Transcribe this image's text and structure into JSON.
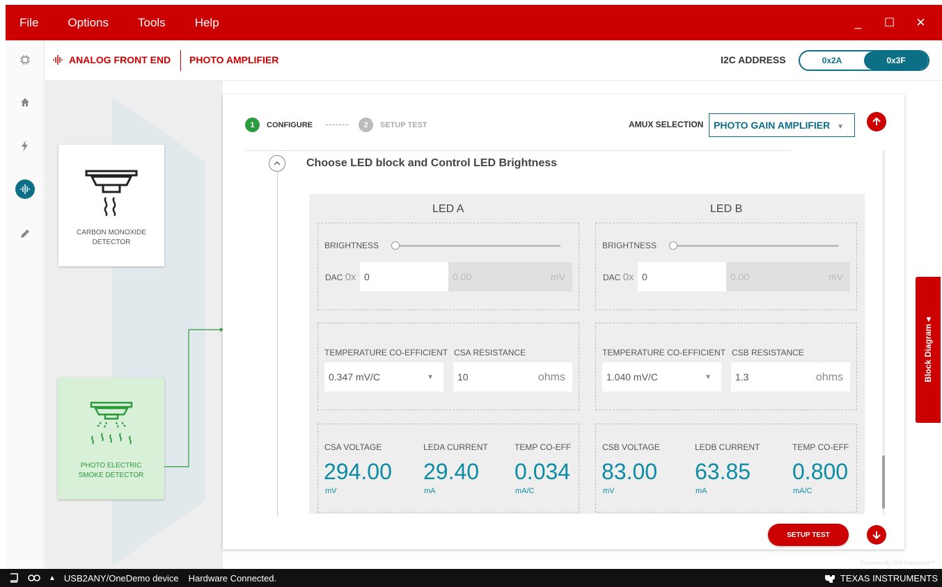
{
  "menu": {
    "items": [
      "File",
      "Options",
      "Tools",
      "Help"
    ]
  },
  "window_controls": {
    "minimize": "_",
    "maximize": "☐",
    "close": "✕"
  },
  "header": {
    "afe_label": "ANALOG FRONT END",
    "pa_label": "PHOTO AMPLIFIER",
    "i2c_label": "I2C ADDRESS",
    "i2c_options": [
      "0x2A",
      "0x3F"
    ],
    "i2c_selected": "0x3F"
  },
  "diagram": {
    "co_label_1": "CARBON MONOXIDE",
    "co_label_2": "DETECTOR",
    "pe_label_1": "PHOTO ELECTRIC",
    "pe_label_2": "SMOKE DETECTOR"
  },
  "steps": {
    "step1_num": "1",
    "step1_label": "CONFIGURE",
    "step2_num": "2",
    "step2_label": "SETUP TEST"
  },
  "amux": {
    "label": "AMUX SELECTION",
    "value": "PHOTO GAIN AMPLIFIER"
  },
  "section": {
    "title": "Choose LED block and Control LED Brightness"
  },
  "led_a": {
    "title": "LED A",
    "brightness_label": "BRIGHTNESS",
    "brightness_level": 0,
    "dac_label": "DAC",
    "dac_prefix": "0x",
    "dac_value": "0",
    "mv_value": "0.00",
    "mv_unit": "mV",
    "tc_label": "TEMPERATURE CO-EFFICIENT",
    "tc_value": "0.347 mV/C",
    "res_label": "CSA RESISTANCE",
    "res_value": "10",
    "res_unit": "ohms",
    "v_label": "CSA VOLTAGE",
    "v_value": "294.00",
    "v_unit": "mV",
    "i_label": "LEDA CURRENT",
    "i_value": "29.40",
    "i_unit": "mA",
    "t_label": "TEMP CO-EFF",
    "t_value": "0.034",
    "t_unit": "mA/C"
  },
  "led_b": {
    "title": "LED B",
    "brightness_label": "BRIGHTNESS",
    "brightness_level": 0,
    "dac_label": "DAC",
    "dac_prefix": "0x",
    "dac_value": "0",
    "mv_value": "0.00",
    "mv_unit": "mV",
    "tc_label": "TEMPERATURE CO-EFFICIENT",
    "tc_value": "1.040 mV/C",
    "res_label": "CSB RESISTANCE",
    "res_value": "1.3",
    "res_unit": "ohms",
    "v_label": "CSB VOLTAGE",
    "v_value": "83.00",
    "v_unit": "mV",
    "i_label": "LEDB CURRENT",
    "i_value": "63.85",
    "i_unit": "mA",
    "t_label": "TEMP CO-EFF",
    "t_value": "0.800",
    "t_unit": "mA/C"
  },
  "buttons": {
    "setup_test": "SETUP TEST",
    "block_diagram": "Block Diagram ◂"
  },
  "powered_by": "Powered By GUI Composer™",
  "status": {
    "device": "USB2ANY/OneDemo device",
    "connection": "Hardware Connected.",
    "brand": "TEXAS INSTRUMENTS"
  },
  "colors": {
    "brand_red": "#cc0000",
    "teal": "#0c6f86",
    "value_teal": "#0c8ca3",
    "green": "#2e9a3e"
  }
}
